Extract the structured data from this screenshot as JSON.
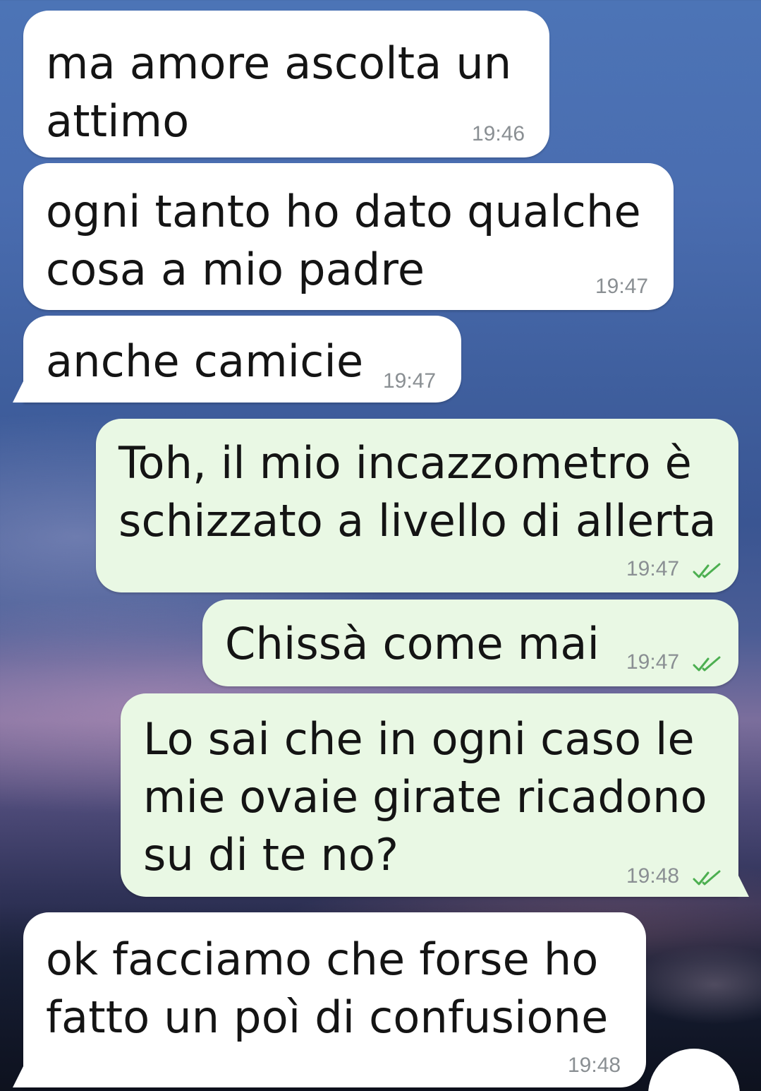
{
  "messages": [
    {
      "direction": "incoming",
      "text": "ma amore ascolta un\nattimo",
      "time": "19:46"
    },
    {
      "direction": "incoming",
      "text": "ogni tanto ho dato qualche\ncosa a mio padre",
      "time": "19:47"
    },
    {
      "direction": "incoming",
      "text": "anche camicie",
      "time": "19:47"
    },
    {
      "direction": "outgoing",
      "text": "Toh, il mio incazzometro è\nschizzato a livello di allerta",
      "time": "19:47",
      "status": "read"
    },
    {
      "direction": "outgoing",
      "text": "Chissà come mai",
      "time": "19:47",
      "status": "read"
    },
    {
      "direction": "outgoing",
      "text": "Lo sai che in ogni caso le\nmie ovaie girate ricadono\nsu di te no?",
      "time": "19:48",
      "status": "read"
    },
    {
      "direction": "incoming",
      "text": "ok facciamo che forse ho\nfatto un poì di confusione",
      "time": "19:48"
    }
  ],
  "colors": {
    "incoming_bubble": "#ffffff",
    "outgoing_bubble": "#e9f8e4",
    "read_check": "#4caf50",
    "timestamp": "#8a8f93"
  },
  "icons": {
    "read_status": "double-check-icon"
  }
}
